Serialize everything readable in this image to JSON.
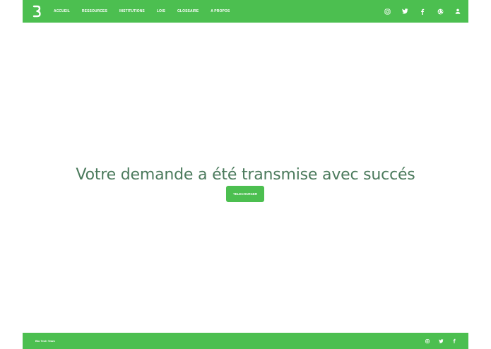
{
  "brand": {
    "logo_letter": "B"
  },
  "nav": {
    "items": [
      {
        "id": "accueil",
        "label": "ACCUEIL"
      },
      {
        "id": "ressources",
        "label": "RESSOURCES"
      },
      {
        "id": "institutions",
        "label": "INSTITUTIONS"
      },
      {
        "id": "lois",
        "label": "LOIS"
      },
      {
        "id": "glossaire",
        "label": "GLOSSAIRE"
      },
      {
        "id": "apropos",
        "label": "A PROPOS"
      }
    ]
  },
  "header_icons": [
    "instagram-icon",
    "twitter-icon",
    "facebook-icon",
    "globe-icon",
    "user-icon"
  ],
  "main": {
    "message": "Votre demande a été transmise avec succés",
    "download_label": "TELECHARGER"
  },
  "footer": {
    "brand": "Bio Tech Team",
    "icons": [
      "instagram-icon",
      "twitter-icon",
      "facebook-icon"
    ]
  },
  "colors": {
    "primary": "#4cbf50",
    "message_text": "#4b7a5c"
  }
}
